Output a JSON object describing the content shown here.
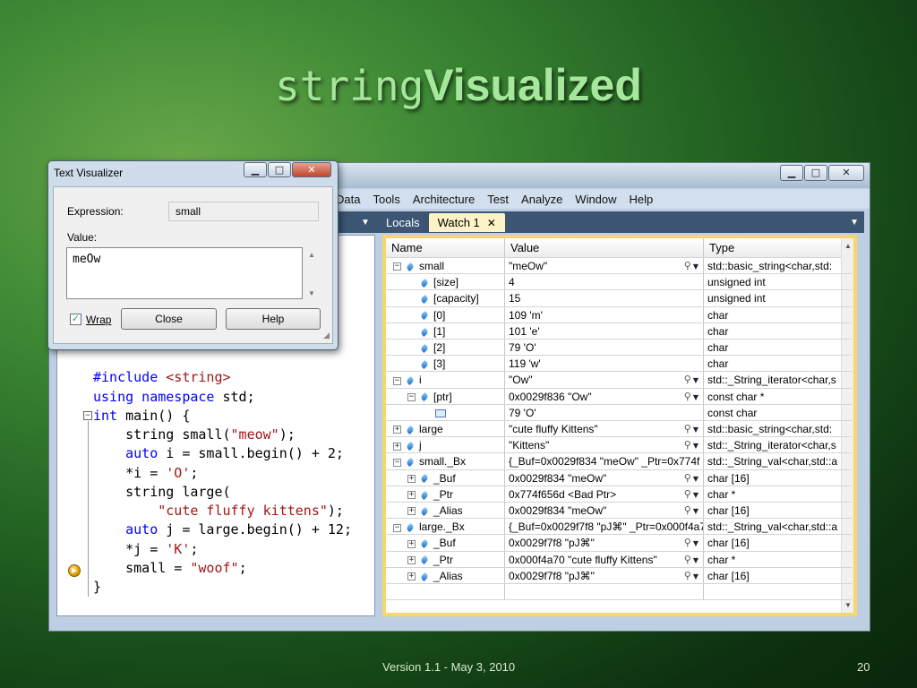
{
  "slide": {
    "title_mono": "string",
    "title_sans": "Visualized",
    "footer": "Version 1.1 - May 3, 2010",
    "page_number": "20"
  },
  "vs": {
    "menu": [
      "Data",
      "Tools",
      "Architecture",
      "Test",
      "Analyze",
      "Window",
      "Help"
    ],
    "tabs": {
      "locals": "Locals",
      "watch": "Watch 1",
      "close": "✕"
    },
    "watch_headers": {
      "name": "Name",
      "value": "Value",
      "type": "Type"
    },
    "watch_rows": [
      {
        "indent": 0,
        "expander": "−",
        "icon": "var",
        "name": "small",
        "value": "\"meOw\"",
        "mag": true,
        "type": "std::basic_string<char,std:"
      },
      {
        "indent": 1,
        "expander": "",
        "icon": "var",
        "name": "[size]",
        "value": "4",
        "mag": false,
        "type": "unsigned int"
      },
      {
        "indent": 1,
        "expander": "",
        "icon": "var",
        "name": "[capacity]",
        "value": "15",
        "mag": false,
        "type": "unsigned int"
      },
      {
        "indent": 1,
        "expander": "",
        "icon": "var",
        "name": "[0]",
        "value": "109 'm'",
        "mag": false,
        "type": "char"
      },
      {
        "indent": 1,
        "expander": "",
        "icon": "var",
        "name": "[1]",
        "value": "101 'e'",
        "mag": false,
        "type": "char"
      },
      {
        "indent": 1,
        "expander": "",
        "icon": "var",
        "name": "[2]",
        "value": "79 'O'",
        "mag": false,
        "type": "char"
      },
      {
        "indent": 1,
        "expander": "",
        "icon": "var",
        "name": "[3]",
        "value": "119 'w'",
        "mag": false,
        "type": "char"
      },
      {
        "indent": 0,
        "expander": "−",
        "icon": "var",
        "name": "i",
        "value": "\"Ow\"",
        "mag": true,
        "type": "std::_String_iterator<char,s"
      },
      {
        "indent": 1,
        "expander": "−",
        "icon": "var",
        "name": "[ptr]",
        "value": "0x0029f836 \"Ow\"",
        "mag": true,
        "type": "const char *"
      },
      {
        "indent": 2,
        "expander": "",
        "icon": "mem",
        "name": "",
        "value": "79 'O'",
        "mag": false,
        "type": "const char"
      },
      {
        "indent": 0,
        "expander": "+",
        "icon": "var",
        "name": "large",
        "value": "\"cute fluffy Kittens\"",
        "mag": true,
        "type": "std::basic_string<char,std:"
      },
      {
        "indent": 0,
        "expander": "+",
        "icon": "var",
        "name": "j",
        "value": "\"Kittens\"",
        "mag": true,
        "type": "std::_String_iterator<char,s"
      },
      {
        "indent": 0,
        "expander": "−",
        "icon": "var",
        "name": "small._Bx",
        "value": "{_Buf=0x0029f834 \"meOw\" _Ptr=0x774f",
        "mag": false,
        "type": "std::_String_val<char,std::a"
      },
      {
        "indent": 1,
        "expander": "+",
        "icon": "var",
        "name": "_Buf",
        "value": "0x0029f834 \"meOw\"",
        "mag": true,
        "type": "char [16]"
      },
      {
        "indent": 1,
        "expander": "+",
        "icon": "var",
        "name": "_Ptr",
        "value": "0x774f656d <Bad Ptr>",
        "mag": true,
        "type": "char *"
      },
      {
        "indent": 1,
        "expander": "+",
        "icon": "var",
        "name": "_Alias",
        "value": "0x0029f834 \"meOw\"",
        "mag": true,
        "type": "char [16]"
      },
      {
        "indent": 0,
        "expander": "−",
        "icon": "var",
        "name": "large._Bx",
        "value": "{_Buf=0x0029f7f8 \"pJ⌘\" _Ptr=0x000f4a7",
        "mag": false,
        "type": "std::_String_val<char,std::a"
      },
      {
        "indent": 1,
        "expander": "+",
        "icon": "var",
        "name": "_Buf",
        "value": "0x0029f7f8 \"pJ⌘\"",
        "mag": true,
        "type": "char [16]"
      },
      {
        "indent": 1,
        "expander": "+",
        "icon": "var",
        "name": "_Ptr",
        "value": "0x000f4a70 \"cute fluffy Kittens\"",
        "mag": true,
        "type": "char *"
      },
      {
        "indent": 1,
        "expander": "+",
        "icon": "var",
        "name": "_Alias",
        "value": "0x0029f7f8 \"pJ⌘\"",
        "mag": true,
        "type": "char [16]"
      },
      {
        "indent": 0,
        "expander": "",
        "icon": "",
        "name": "",
        "value": "",
        "mag": false,
        "type": ""
      }
    ],
    "code": [
      {
        "parts": [
          [
            "kw",
            "#include "
          ],
          [
            "str",
            "<string>"
          ]
        ]
      },
      {
        "parts": [
          [
            "kw",
            "using namespace "
          ],
          [
            "",
            "std;"
          ]
        ]
      },
      {
        "parts": [
          [
            "kw",
            "int "
          ],
          [
            "",
            "main() {"
          ]
        ]
      },
      {
        "parts": [
          [
            "",
            "    string small("
          ],
          [
            "str",
            "\"meow\""
          ],
          [
            "",
            ");"
          ]
        ]
      },
      {
        "parts": [
          [
            "kw",
            "    auto "
          ],
          [
            "",
            "i = small.begin() + 2;"
          ]
        ]
      },
      {
        "parts": [
          [
            "",
            "    *i = "
          ],
          [
            "str",
            "'O'"
          ],
          [
            "",
            ";"
          ]
        ]
      },
      {
        "parts": [
          [
            "",
            "    string large("
          ]
        ]
      },
      {
        "parts": [
          [
            "str",
            "        \"cute fluffy kittens\""
          ],
          [
            "",
            ");"
          ]
        ]
      },
      {
        "parts": [
          [
            "kw",
            "    auto "
          ],
          [
            "",
            "j = large.begin() + 12;"
          ]
        ]
      },
      {
        "parts": [
          [
            "",
            "    *j = "
          ],
          [
            "str",
            "'K'"
          ],
          [
            "",
            ";"
          ]
        ]
      },
      {
        "parts": [
          [
            "",
            "    small = "
          ],
          [
            "str",
            "\"woof\""
          ],
          [
            "",
            ";"
          ]
        ]
      },
      {
        "parts": [
          [
            "",
            "}"
          ]
        ]
      }
    ]
  },
  "dialog": {
    "title": "Text Visualizer",
    "expression_label": "Expression:",
    "expression_value": "small",
    "value_label": "Value:",
    "value_text": "meOw",
    "wrap_label": "Wrap",
    "wrap_checked": true,
    "close_label": "Close",
    "help_label": "Help"
  },
  "window_controls": {
    "minimize": "▁",
    "maximize": "□",
    "close": "✕"
  }
}
